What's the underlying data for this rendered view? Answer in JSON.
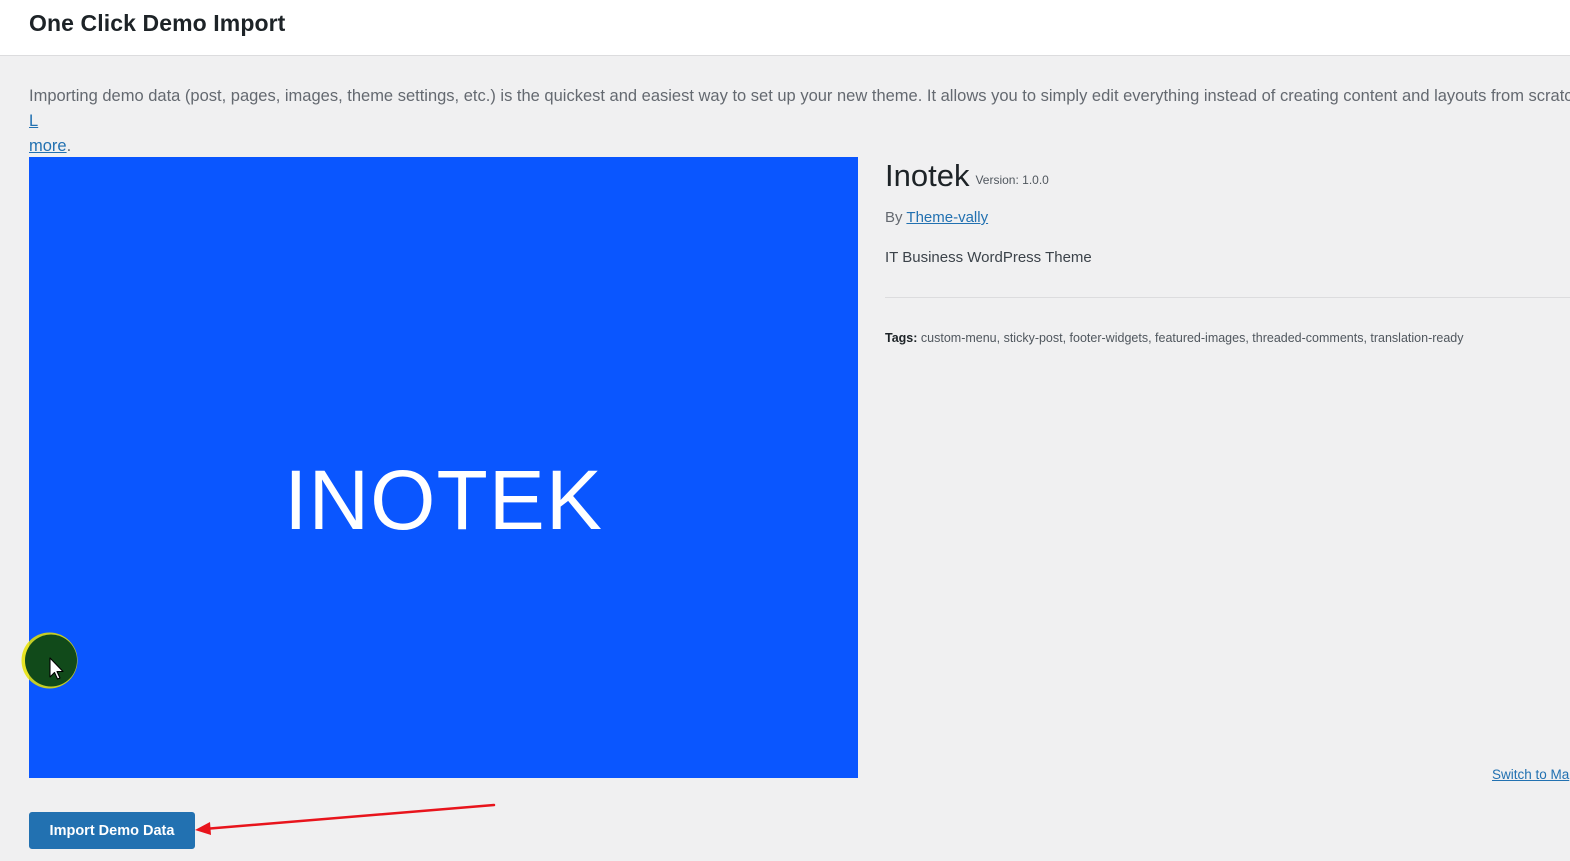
{
  "header": {
    "title": "One Click Demo Import"
  },
  "intro": {
    "text": "Importing demo data (post, pages, images, theme settings, etc.) is the quickest and easiest way to set up your new theme. It allows you to simply edit everything instead of creating content and layouts from scratch. ",
    "link_start": "L",
    "link_end": "more"
  },
  "preview": {
    "logo_text": "INOTEK",
    "background_color": "#0a56ff"
  },
  "theme": {
    "name": "Inotek",
    "version_label": "Version: 1.0.0",
    "by_label": "By ",
    "author": "Theme-vally",
    "description": "IT Business WordPress Theme",
    "tags_label": "Tags:",
    "tags": "custom-menu, sticky-post, footer-widgets, featured-images, threaded-comments, translation-ready"
  },
  "switch_link": "Switch to Ma",
  "actions": {
    "import_label": "Import Demo Data"
  },
  "colors": {
    "accent": "#2271b1",
    "annotation": "#e8141c"
  },
  "icons": {
    "cursor": "mouse-cursor-icon"
  }
}
